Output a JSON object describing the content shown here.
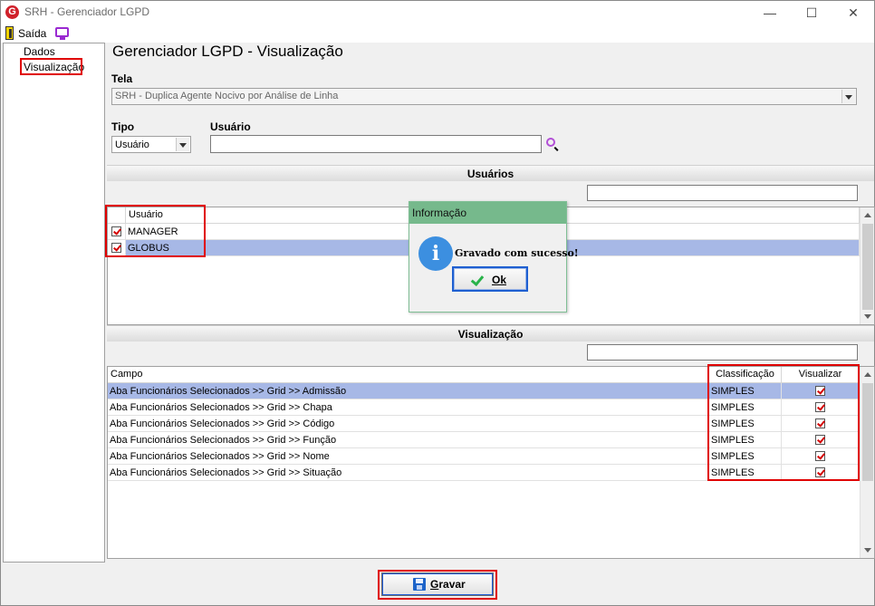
{
  "window": {
    "title": "SRH - Gerenciador LGPD",
    "logo_letter": "G",
    "minimize": "—",
    "maximize": "☐",
    "close": "✕"
  },
  "menu": {
    "saida_label": "Saída"
  },
  "tree": {
    "items": [
      {
        "label": "Dados"
      },
      {
        "label": "Visualização"
      }
    ]
  },
  "page": {
    "title": "Gerenciador LGPD - Visualização"
  },
  "form": {
    "tela_label": "Tela",
    "tela_value": "SRH - Duplica Agente Nocivo por Análise de Linha",
    "tipo_label": "Tipo",
    "tipo_value": "Usuário",
    "usuario_label": "Usuário",
    "usuario_value": ""
  },
  "usuarios_section": {
    "title": "Usuários",
    "search_value": "",
    "column": "Usuário",
    "rows": [
      {
        "name": "MANAGER",
        "checked": true,
        "selected": false
      },
      {
        "name": "GLOBUS",
        "checked": true,
        "selected": true
      }
    ]
  },
  "visualizacao_section": {
    "title": "Visualização",
    "search_value": "",
    "columns": {
      "campo": "Campo",
      "classificacao": "Classificação",
      "visualizar": "Visualizar"
    },
    "rows": [
      {
        "campo": "Aba Funcionários Selecionados >> Grid >> Admissão",
        "classificacao": "SIMPLES",
        "visualizar": true,
        "selected": true
      },
      {
        "campo": "Aba Funcionários Selecionados >> Grid >> Chapa",
        "classificacao": "SIMPLES",
        "visualizar": true,
        "selected": false
      },
      {
        "campo": "Aba Funcionários Selecionados >> Grid >> Código",
        "classificacao": "SIMPLES",
        "visualizar": true,
        "selected": false
      },
      {
        "campo": "Aba Funcionários Selecionados >> Grid >> Função",
        "classificacao": "SIMPLES",
        "visualizar": true,
        "selected": false
      },
      {
        "campo": "Aba Funcionários Selecionados >> Grid >> Nome",
        "classificacao": "SIMPLES",
        "visualizar": true,
        "selected": false
      },
      {
        "campo": "Aba Funcionários Selecionados >> Grid >> Situação",
        "classificacao": "SIMPLES",
        "visualizar": true,
        "selected": false
      }
    ]
  },
  "dialog": {
    "title": "Informação",
    "icon": "i",
    "message": "Gravado com sucesso!",
    "ok_label": "Ok"
  },
  "footer": {
    "gravar_first": "G",
    "gravar_rest": "ravar"
  },
  "colors": {
    "highlight": "#e00000",
    "selection": "#a7b8e6",
    "dialog_title": "#76b98c",
    "accent": "#1c63c9"
  }
}
